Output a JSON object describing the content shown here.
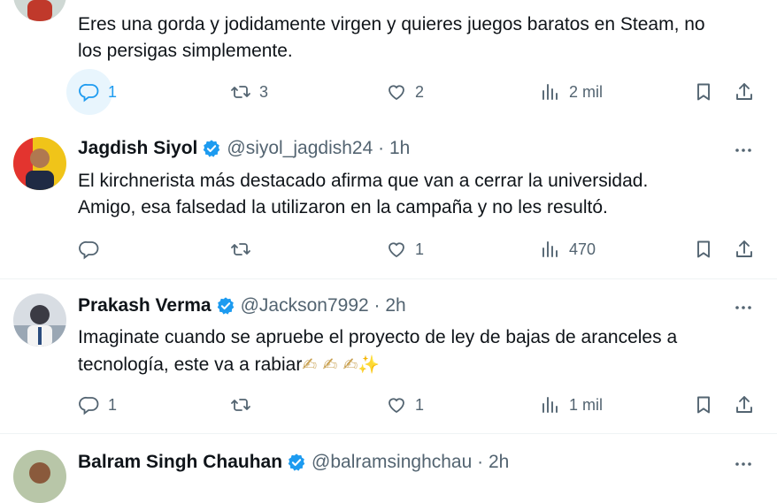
{
  "tweets": [
    {
      "name": "",
      "handle": "",
      "text_line1": "Eres una gorda y jodidamente virgen y quieres juegos baratos en Steam, no",
      "text_line2": "los persigas simplemente.",
      "replies": "1",
      "retweets": "3",
      "likes": "2",
      "views": "2 mil"
    },
    {
      "name": "Jagdish Siyol",
      "handle": "@siyol_jagdish24 · 1h",
      "text_line1": "El kirchnerista más destacado afirma que van a cerrar la universidad.",
      "text_line2": "Amigo, esa falsedad la utilizaron en la campaña y no les resultó.",
      "replies": "",
      "retweets": "",
      "likes": "1",
      "views": "470"
    },
    {
      "name": "Prakash Verma",
      "handle": "@Jackson7992 · 2h",
      "text_line1": "Imaginate cuando se apruebe el proyecto de ley de bajas de aranceles a",
      "text_line2": "tecnología, este va a rabiar",
      "emojis": "✍ ✍ ✍",
      "sparkle": "✨",
      "replies": "1",
      "retweets": "",
      "likes": "1",
      "views": "1 mil"
    },
    {
      "name": "Balram Singh Chauhan",
      "handle": "@balramsinghchau · 2h"
    }
  ],
  "icons": {
    "reply": "reply-icon",
    "retweet": "retweet-icon",
    "like": "heart-icon",
    "views": "views-icon",
    "bookmark": "bookmark-icon",
    "share": "share-icon",
    "more": "more-icon",
    "verified": "verified-badge-icon"
  },
  "colors": {
    "verified": "#1d9bf0",
    "secondary_text": "#536471",
    "reply_highlight": "#e8f5fd"
  }
}
